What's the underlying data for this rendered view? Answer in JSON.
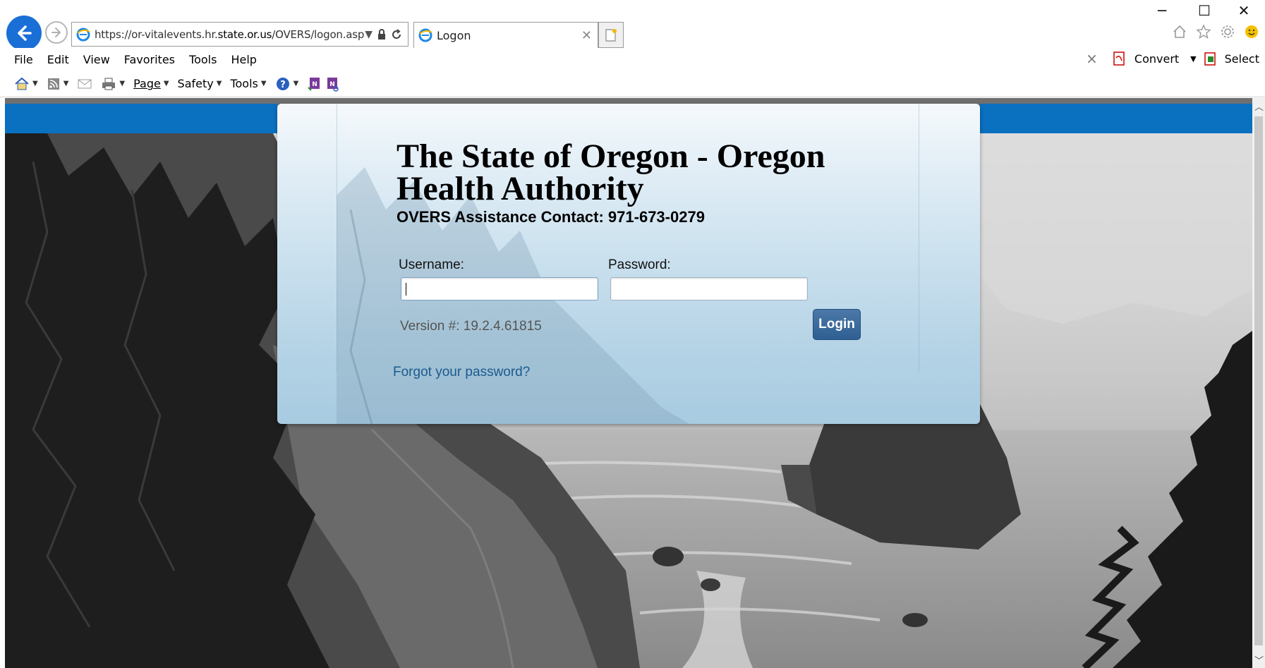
{
  "browser": {
    "url_prefix": "https://or-vitalevents.hr.",
    "url_domain": "state.or.us",
    "url_suffix": "/OVERS/logon.asp",
    "tab_title": "Logon",
    "window_controls": {
      "minimize": "─",
      "maximize": "☐",
      "close": "✕"
    }
  },
  "menubar": {
    "items": [
      "File",
      "Edit",
      "View",
      "Favorites",
      "Tools",
      "Help"
    ],
    "right": {
      "close_icon": "×",
      "convert_label": "Convert",
      "select_label": "Select"
    }
  },
  "commandbar": {
    "page_label": "Page",
    "safety_label": "Safety",
    "tools_label": "Tools"
  },
  "login": {
    "title": "The State of Oregon - Oregon Health Authority",
    "contact": "OVERS Assistance Contact: 971-673-0279",
    "username_label": "Username:",
    "password_label": "Password:",
    "username_value": "",
    "password_value": "",
    "version": "Version #: 19.2.4.61815",
    "login_button": "Login",
    "forgot_link": "Forgot your password?"
  },
  "colors": {
    "brand_blue": "#0a70c0",
    "link": "#1a5a8e",
    "button": "#3a6a9c"
  }
}
